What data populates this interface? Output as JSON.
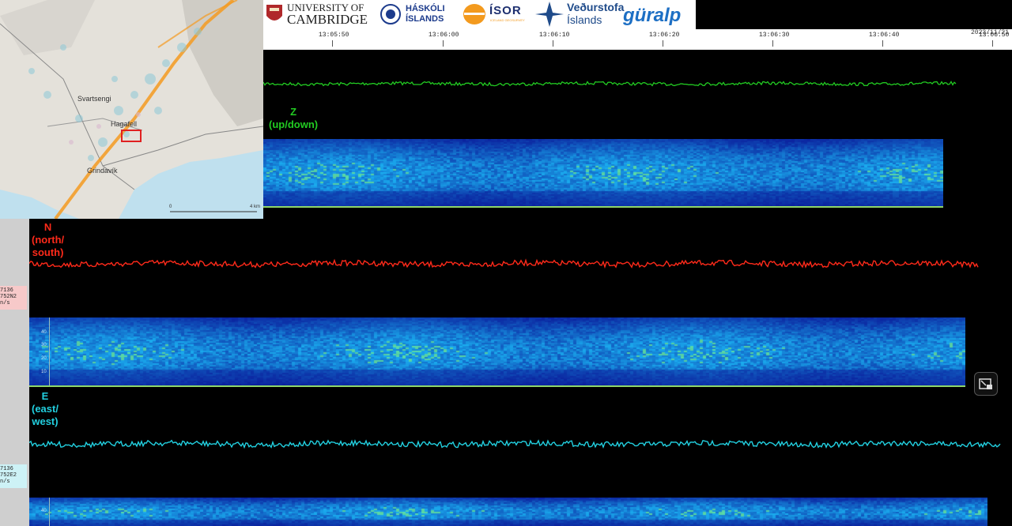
{
  "map": {
    "labels": [
      "Svartsengi",
      "Hagafell",
      "Grindavík"
    ],
    "scale_left": "0",
    "scale_right": "4 km"
  },
  "logos": {
    "cambridge_line1": "UNIVERSITY OF",
    "cambridge_line2": "CAMBRIDGE",
    "hi_line1": "HÁSKÓLI",
    "hi_line2": "ÍSLANDS",
    "isor": "ÍSOR",
    "isor_sub": "ICELAND GEOSURVEY",
    "vedur_line1": "Veðurstofa",
    "vedur_line2": "Íslands",
    "guralp": "güralp"
  },
  "axis": {
    "date": "2023/11/21",
    "ticks": [
      "13:05:50",
      "13:06:00",
      "13:06:10",
      "13:06:20",
      "13:06:30",
      "13:06:40",
      "13:06:50"
    ]
  },
  "channels": {
    "z": {
      "label_line1": "Z",
      "label_line2": "(up/down)",
      "color": "#22cc22"
    },
    "n": {
      "label_line1": "N",
      "label_line2": "(north/",
      "label_line3": "south)",
      "color": "#ff2a1a",
      "info_line1": "7136",
      "info_line2": "752N2",
      "info_line3": "n/s"
    },
    "e": {
      "label_line1": "E",
      "label_line2": "(east/",
      "label_line3": "west)",
      "color": "#22d0e0",
      "info_line1": "7136",
      "info_line2": "752E2",
      "info_line3": "n/s"
    }
  },
  "spectrogram_yaxis": [
    "40",
    "30",
    "20",
    "10"
  ],
  "colors": {
    "background": "#000000",
    "spec_low": "#0a1a9a",
    "spec_high": "#1ec8ff"
  },
  "icons": {
    "pip": "picture-in-picture-exit-icon"
  }
}
